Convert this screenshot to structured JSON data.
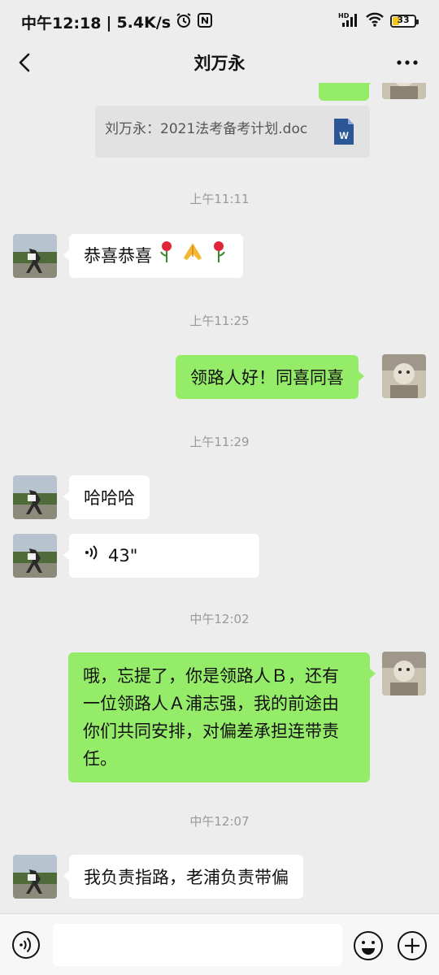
{
  "status_bar": {
    "time": "中午12:18",
    "separator": "|",
    "net_speed": "5.4K/s",
    "network_type": "HD",
    "battery": "33",
    "icons": [
      "alarm-icon",
      "nfc-icon",
      "signal-icon",
      "wifi-icon",
      "battery-icon"
    ]
  },
  "nav": {
    "title": "刘万永",
    "back_icon": "back-chevron-icon",
    "more_icon": "more-dots-icon"
  },
  "chat": {
    "file_card": {
      "text": "刘万永：2021法考备考计划.doc",
      "icon": "word-file-icon"
    },
    "ts1": "上午11:11",
    "msg1": "恭喜恭喜",
    "msg1_emojis": [
      "rose-icon",
      "praying-hands-icon",
      "rose-icon"
    ],
    "ts2": "上午11:25",
    "msg2": "领路人好！同喜同喜",
    "ts3": "上午11:29",
    "msg3": "哈哈哈",
    "voice_duration": "43\"",
    "ts4": "中午12:02",
    "msg4_lines": [
      "哦，忘提了，你是领路人Ｂ，还有",
      "一位领路人Ａ浦志强，我的前途由",
      "你们共同安排，对偏差承担连带责",
      "任。"
    ],
    "ts5": "中午12:07",
    "msg5": "我负责指路，老浦负责带偏"
  },
  "input_bar": {
    "placeholder": "",
    "icons": [
      "voice-input-icon",
      "emoji-icon",
      "plus-icon"
    ]
  },
  "colors": {
    "background": "#ededed",
    "my_bubble": "#95ec69",
    "their_bubble": "#ffffff",
    "timestamp": "#999999"
  }
}
